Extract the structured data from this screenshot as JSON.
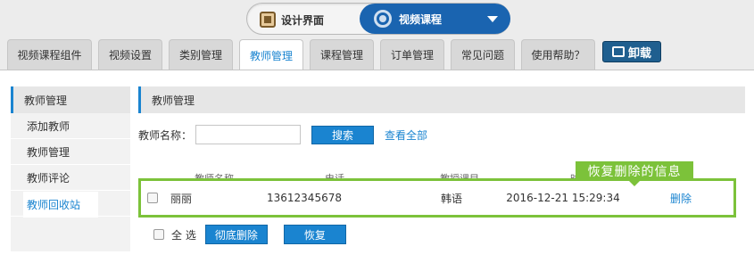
{
  "switcher": {
    "design_label": "设计界面",
    "video_label": "视频课程"
  },
  "tabs": [
    {
      "label": "视频课程组件"
    },
    {
      "label": "视频设置"
    },
    {
      "label": "类别管理"
    },
    {
      "label": "教师管理"
    },
    {
      "label": "课程管理"
    },
    {
      "label": "订单管理"
    },
    {
      "label": "常见问题"
    },
    {
      "label": "使用帮助？"
    }
  ],
  "uninstall_label": "卸载",
  "sidebar": {
    "title": "教师管理",
    "items": [
      {
        "label": "添加教师"
      },
      {
        "label": "教师管理"
      },
      {
        "label": "教师评论"
      },
      {
        "label": "教师回收站"
      }
    ]
  },
  "content": {
    "title": "教师管理",
    "search_label": "教师名称：",
    "search_value": "",
    "search_button": "搜索",
    "view_all": "查看全部",
    "columns": [
      "教师名称",
      "电话",
      "教授课目",
      "时间",
      "操作"
    ],
    "row": {
      "name": "丽丽",
      "phone": "13612345678",
      "subject": "韩语",
      "time": "2016-12-21 15:29:34",
      "action": "删除"
    },
    "tooltip": "恢复删除的信息",
    "select_all": "全 选",
    "delete_button": "彻底删除",
    "restore_button": "恢复"
  },
  "colors": {
    "accent": "#1a84d0",
    "highlight": "#7cc23a",
    "switch_active": "#1a64b0"
  }
}
